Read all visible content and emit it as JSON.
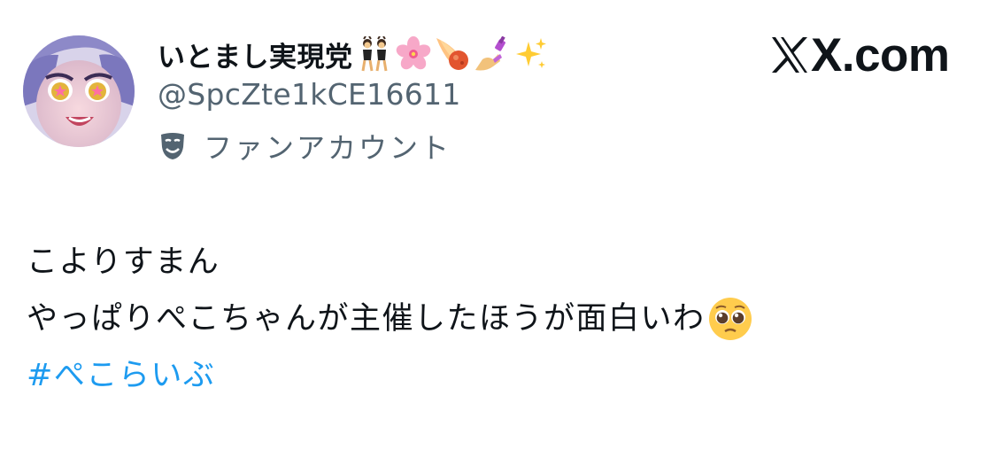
{
  "author": {
    "display_name": "いとまし実現党",
    "display_name_emojis": [
      "dancers-emoji",
      "cherry-blossom-emoji",
      "comet-emoji",
      "nail-polish-emoji",
      "sparkles-emoji"
    ],
    "handle": "@SpcZte1kCE16611",
    "account_label": "ファンアカウント",
    "account_label_icon": "performing-arts-mask-icon"
  },
  "brand": {
    "domain": "X.com"
  },
  "tweet": {
    "lines": [
      "こよりすまん",
      "やっぱりぺこちゃんが主催したほうが面白いわ"
    ],
    "line2_trailing_emoji": "pleading-face-emoji",
    "hashtag": "#ぺこらいぶ"
  },
  "colors": {
    "text_primary": "#0f1419",
    "text_secondary": "#536471",
    "link": "#1d9bf0",
    "background": "#ffffff"
  }
}
